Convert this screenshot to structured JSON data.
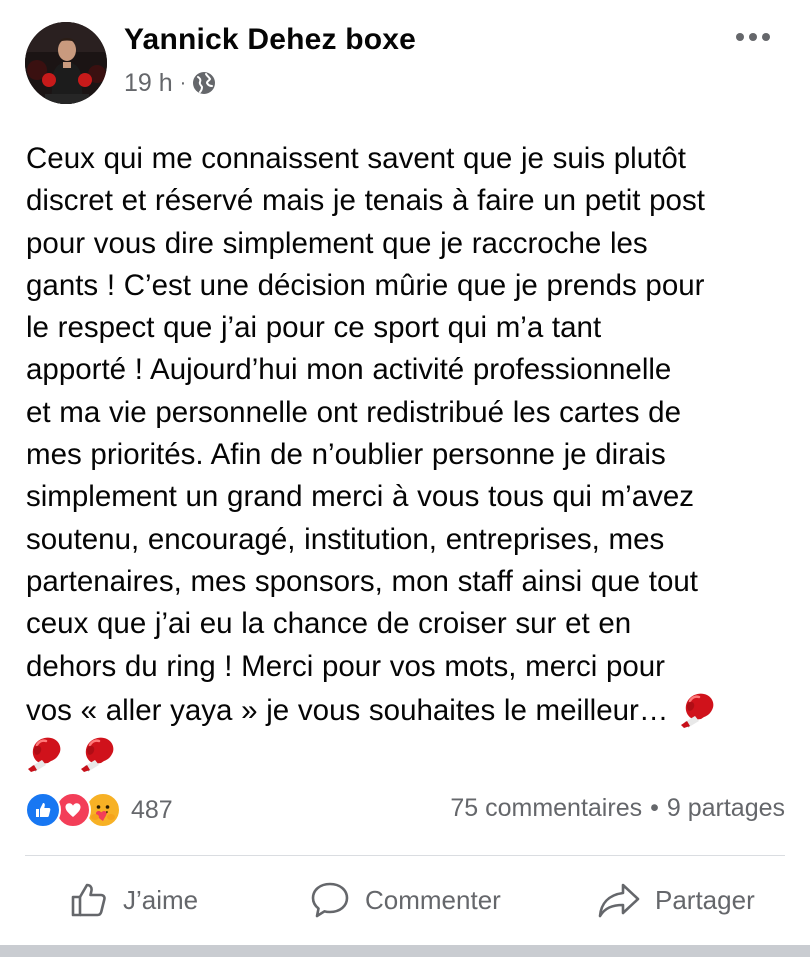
{
  "post": {
    "author": "Yannick Dehez boxe",
    "time": "19 h",
    "separator": "·",
    "privacy_icon": "globe-icon",
    "body_lines": [
      "Ceux qui me connaissent savent que je suis plutôt",
      "discret et réservé mais je tenais à faire un petit post",
      "pour vous dire simplement que je raccroche les",
      "gants ! C’est une décision mûrie que je prends pour",
      "le respect que j’ai pour ce sport qui m’a tant",
      "apporté ! Aujourd’hui mon activité professionnelle",
      "et ma vie personnelle ont redistribué les cartes de",
      "mes priorités. Afin de n’oublier personne je dirais",
      "simplement un grand merci à vous tous qui m’avez",
      "soutenu, encouragé, institution, entreprises, mes",
      "partenaires, mes sponsors, mon staff ainsi que tout",
      "ceux que j’ai eu la chance de croiser sur et en",
      "dehors du ring ! Merci pour vos mots, merci pour",
      "vos « aller yaya » je vous souhaites le meilleur…"
    ],
    "emoji": "boxing-glove-emoji"
  },
  "stats": {
    "reactions": [
      "like",
      "love",
      "care"
    ],
    "reaction_count": "487",
    "comments": "75 commentaires",
    "separator": "•",
    "shares": "9 partages"
  },
  "actions": {
    "like": "J’aime",
    "comment": "Commenter",
    "share": "Partager"
  },
  "colors": {
    "like_blue": "#1877f2",
    "love_red": "#f33e58",
    "care_yellow": "#f7b125",
    "secondary_text": "#65676b",
    "glove_red": "#d0121b"
  }
}
